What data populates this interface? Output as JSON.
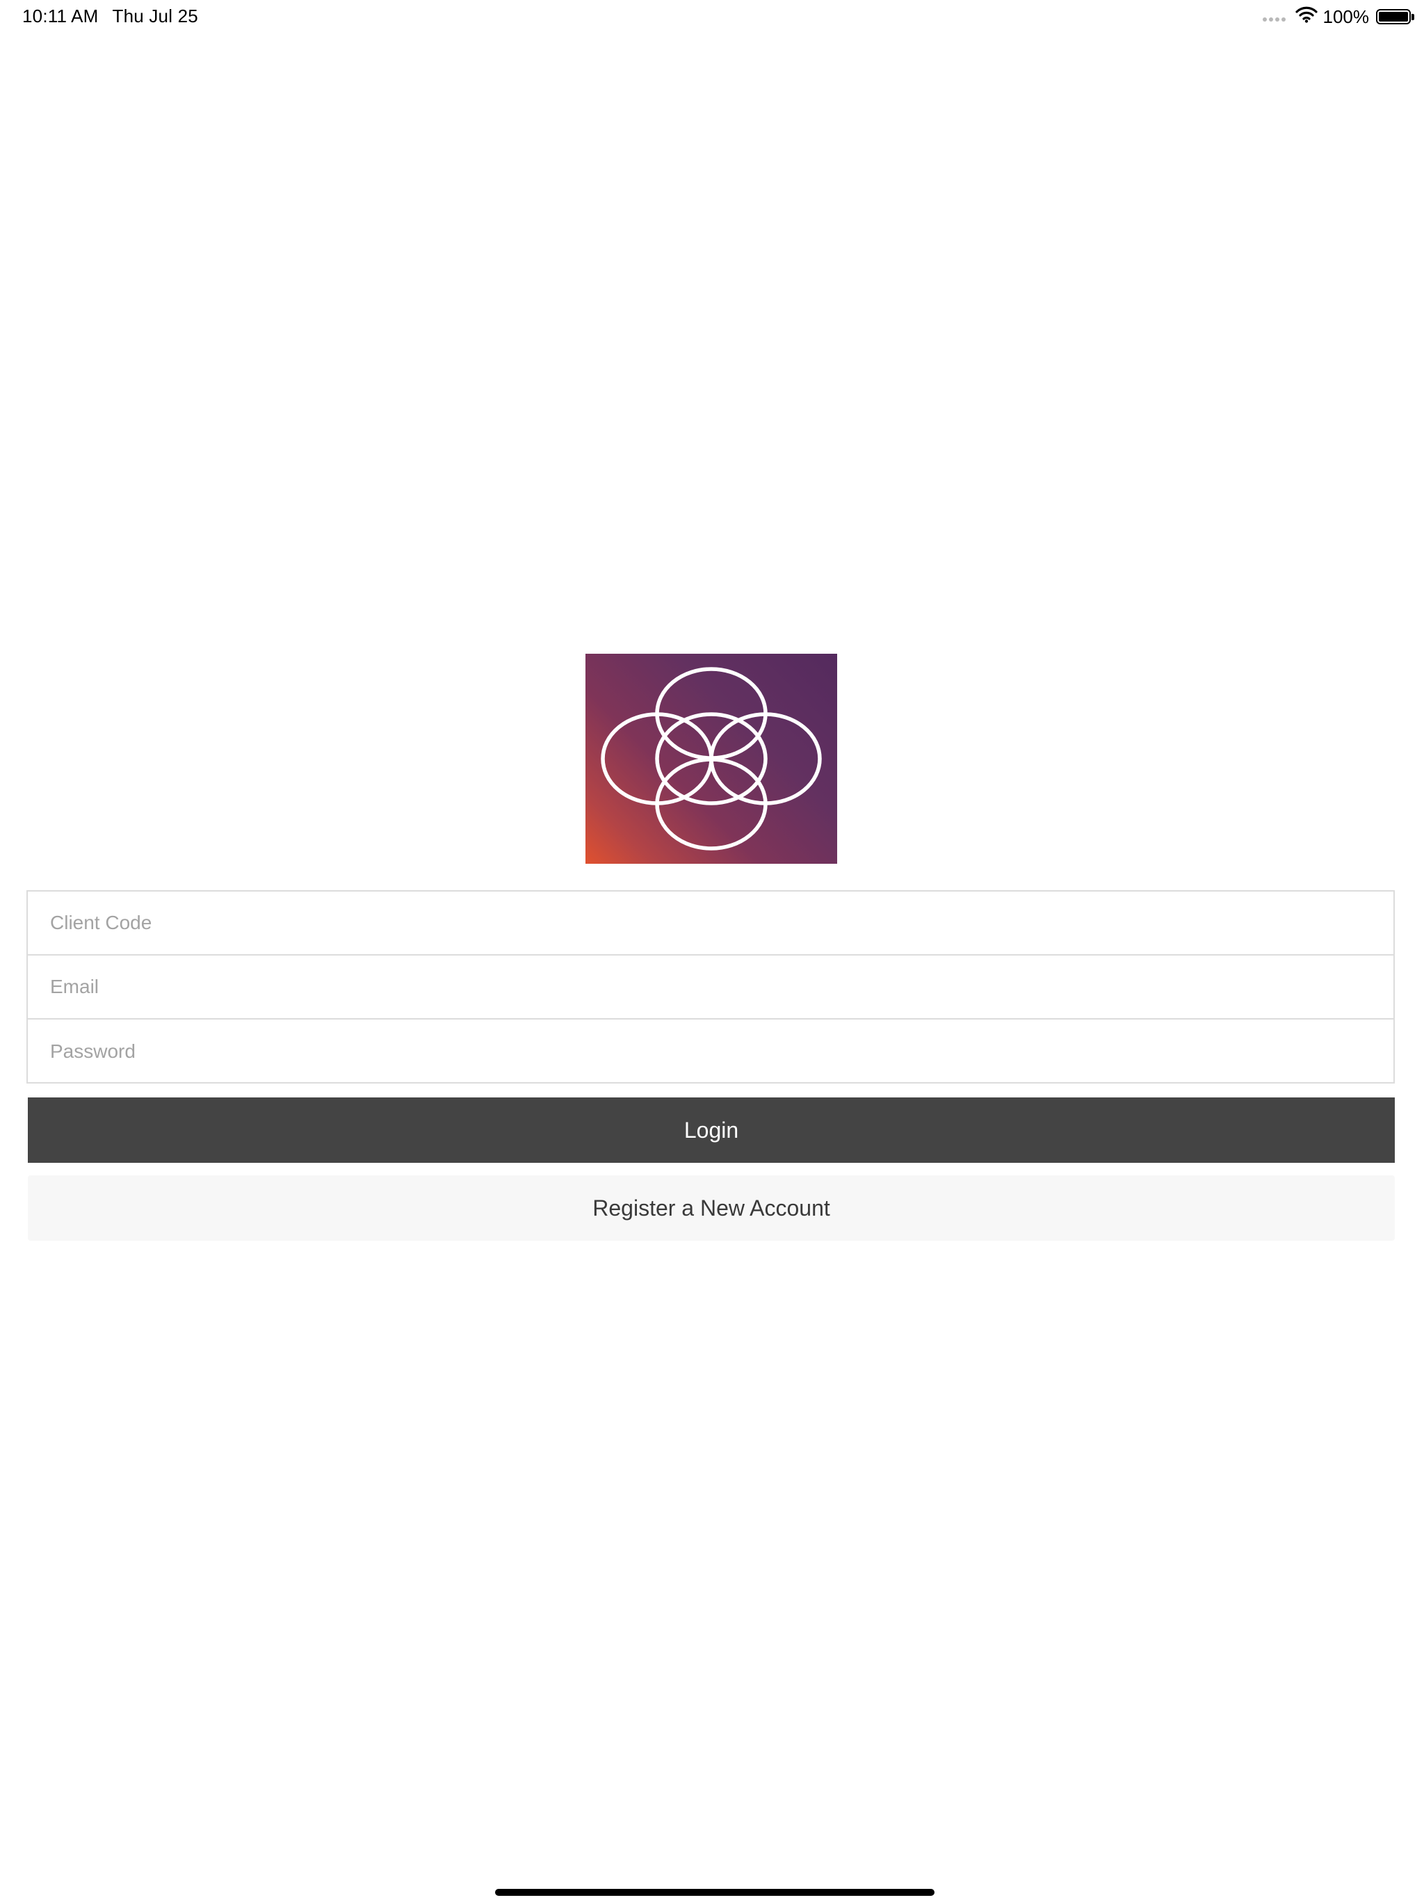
{
  "status_bar": {
    "time": "10:11 AM",
    "date": "Thu Jul 25",
    "battery_percent": "100%",
    "battery_level": 1.0,
    "icons": [
      "cellular-signal-icon",
      "wifi-icon",
      "battery-icon"
    ]
  },
  "logo": {
    "icon": "overlapping-circles-logo",
    "colors": {
      "gradient_top_right": "#542a5e",
      "gradient_bottom_left": "#e0512f",
      "stroke": "#ffffff"
    }
  },
  "form": {
    "client_code": {
      "placeholder": "Client Code",
      "value": ""
    },
    "email": {
      "placeholder": "Email",
      "value": ""
    },
    "password": {
      "placeholder": "Password",
      "value": ""
    }
  },
  "buttons": {
    "login_label": "Login",
    "register_label": "Register a New Account"
  },
  "colors": {
    "login_button_bg": "#444444",
    "login_button_text": "#ffffff",
    "register_button_bg": "#f7f7f7",
    "register_button_text": "#3a3a3a",
    "field_border": "#dcdcdc",
    "placeholder_text": "#a3a3a3"
  }
}
